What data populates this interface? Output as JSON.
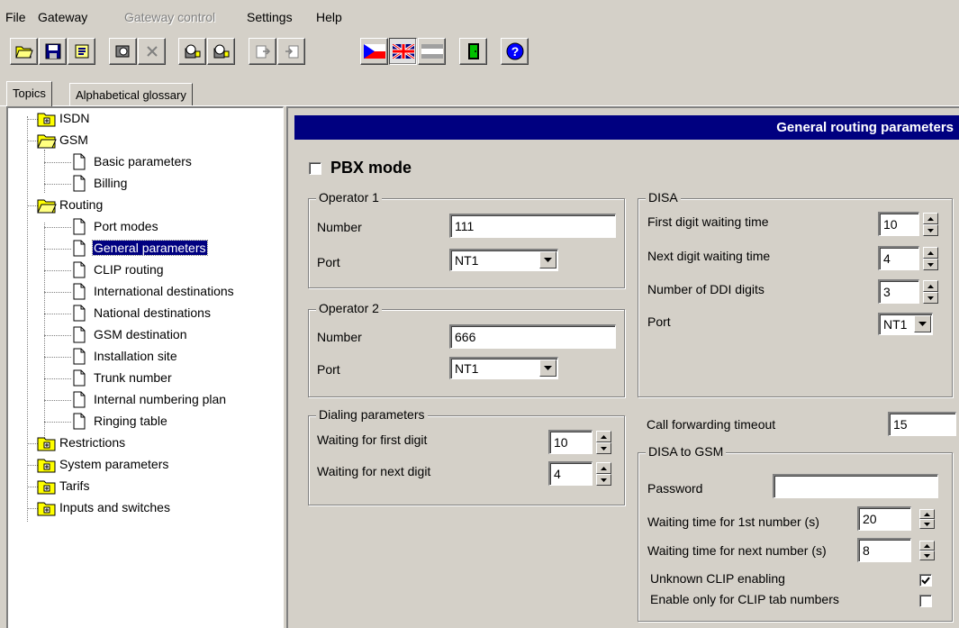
{
  "menu": {
    "file": "File",
    "gateway": "Gateway",
    "gateway_control": "Gateway control",
    "settings": "Settings",
    "help": "Help"
  },
  "toolbar": {
    "icons": [
      "open-folder-icon",
      "save-icon",
      "export-icon",
      "read-gateway-icon",
      "cancel-icon",
      "gateway-read-icon",
      "gateway-write-icon",
      "import-file-icon",
      "export-file-icon",
      "czech-flag-icon",
      "uk-flag-icon",
      "flag-disabled-icon",
      "exit-icon",
      "help-icon"
    ]
  },
  "tabs": {
    "topics": "Topics",
    "glossary": "Alphabetical glossary"
  },
  "tree": {
    "isdn": "ISDN",
    "gsm": "GSM",
    "basic_parameters": "Basic parameters",
    "billing": "Billing",
    "routing": "Routing",
    "port_modes": "Port modes",
    "general_parameters": "General parameters",
    "clip_routing": "CLIP routing",
    "international_destinations": "International destinations",
    "national_destinations": "National destinations",
    "gsm_destination": "GSM destination",
    "installation_site": "Installation site",
    "trunk_number": "Trunk number",
    "internal_numbering_plan": "Internal numbering plan",
    "ringing_table": "Ringing table",
    "restrictions": "Restrictions",
    "system_parameters": "System parameters",
    "tarifs": "Tarifs",
    "inputs_and_switches": "Inputs and switches"
  },
  "header": {
    "title": "General routing parameters"
  },
  "pbx": {
    "label": "PBX mode",
    "checked": false
  },
  "operator1": {
    "title": "Operator 1",
    "number_label": "Number",
    "number_value": "111",
    "port_label": "Port",
    "port_value": "NT1"
  },
  "operator2": {
    "title": "Operator 2",
    "number_label": "Number",
    "number_value": "666",
    "port_label": "Port",
    "port_value": "NT1"
  },
  "dialing": {
    "title": "Dialing parameters",
    "first_label": "Waiting for first digit",
    "first_value": "10",
    "next_label": "Waiting for next digit",
    "next_value": "4"
  },
  "disa": {
    "title": "DISA",
    "first_label": "First digit waiting time",
    "first_value": "10",
    "next_label": "Next digit waiting time",
    "next_value": "4",
    "ddi_label": "Number of DDI digits",
    "ddi_value": "3",
    "port_label": "Port",
    "port_value": "NT1"
  },
  "call_forwarding": {
    "label": "Call forwarding timeout",
    "value": "15"
  },
  "disa_gsm": {
    "title": "DISA to GSM",
    "password_label": "Password",
    "password_value": "",
    "first_label": "Waiting time for 1st number (s)",
    "first_value": "20",
    "next_label": "Waiting time for next number (s)",
    "next_value": "8",
    "unknown_clip_label": "Unknown CLIP enabling",
    "unknown_clip_checked": true,
    "clip_tab_label": "Enable only for CLIP tab numbers",
    "clip_tab_checked": false
  }
}
